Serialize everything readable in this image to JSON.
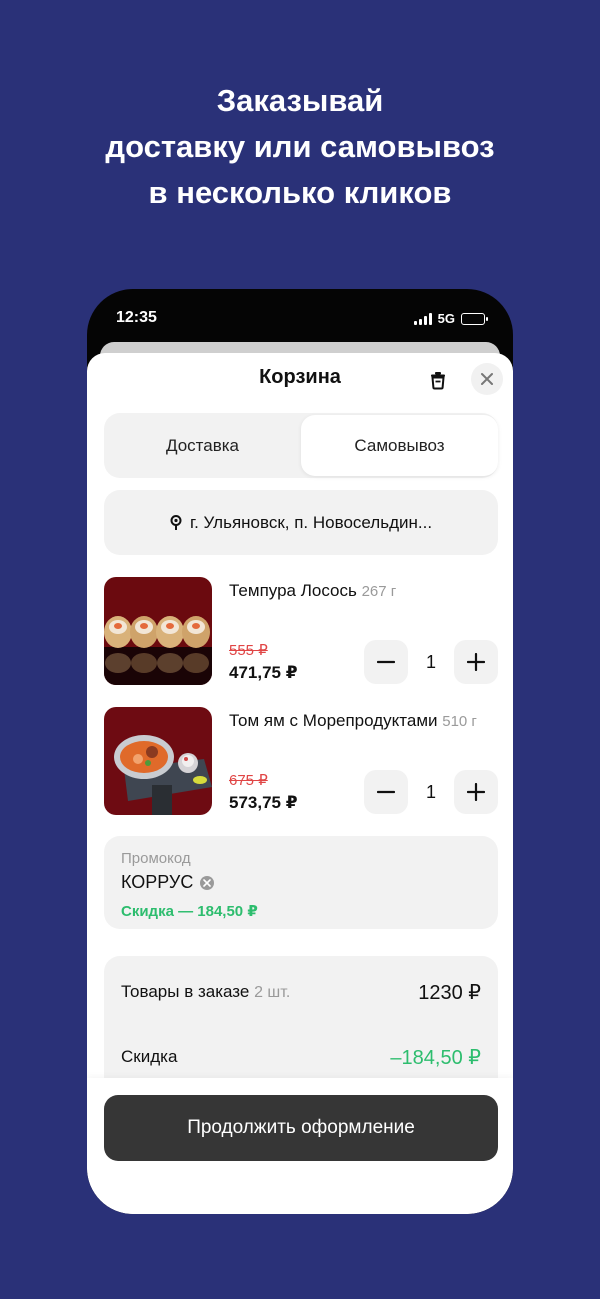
{
  "headline": [
    "Заказывай",
    "доставку или самовывоз",
    "в несколько кликов"
  ],
  "status_bar": {
    "time": "12:35",
    "network": "5G"
  },
  "cart": {
    "title": "Корзина",
    "tabs": [
      {
        "label": "Доставка",
        "selected": false
      },
      {
        "label": "Самовывоз",
        "selected": true
      }
    ],
    "address": "г. Ульяновск, п. Новосельдин...",
    "items": [
      {
        "name": "Темпура Лосось",
        "weight": "267 г",
        "old_price": "555 ₽",
        "price": "471,75 ₽",
        "qty": "1"
      },
      {
        "name": "Том ям с Морепродуктами",
        "weight": "510 г",
        "old_price": "675 ₽",
        "price": "573,75 ₽",
        "qty": "1"
      }
    ],
    "promo": {
      "label": "Промокод",
      "code": "КОРРУС",
      "discount": "Скидка — 184,50 ₽"
    },
    "summary": {
      "items_label": "Товары в заказе",
      "items_count": "2 шт.",
      "items_total": "1230 ₽",
      "discount_label": "Скидка",
      "discount_value": "–184,50 ₽"
    },
    "cta": "Продолжить оформление"
  },
  "colors": {
    "background": "#2a3178",
    "accent_green": "#2dbd6e",
    "old_price_red": "#e04545",
    "cta": "#363636"
  }
}
